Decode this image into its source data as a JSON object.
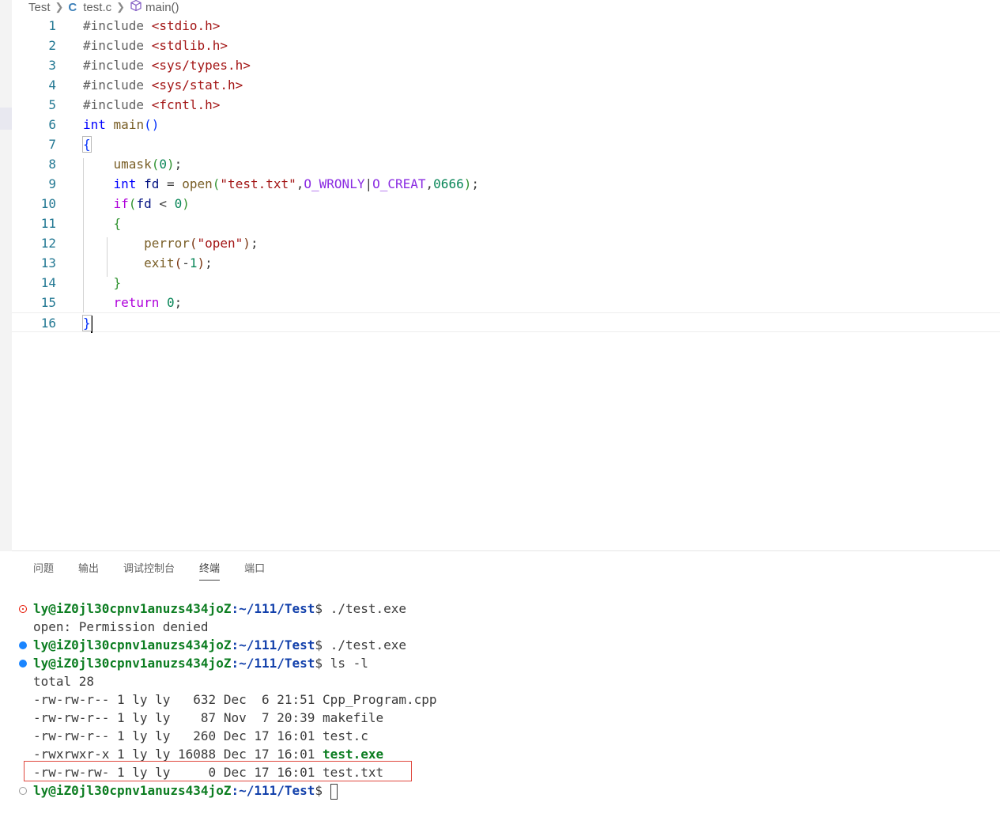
{
  "breadcrumb": {
    "folder": "Test",
    "file_icon": "C",
    "file": "test.c",
    "symbol": "main()",
    "symbol_icon": "cube-icon"
  },
  "editor": {
    "line_numbers": [
      "1",
      "2",
      "3",
      "4",
      "5",
      "6",
      "7",
      "8",
      "9",
      "10",
      "11",
      "12",
      "13",
      "14",
      "15",
      "16"
    ],
    "lines": [
      [
        {
          "c": "pp",
          "t": "#include "
        },
        {
          "c": "inc",
          "t": "<stdio.h>"
        }
      ],
      [
        {
          "c": "pp",
          "t": "#include "
        },
        {
          "c": "inc",
          "t": "<stdlib.h>"
        }
      ],
      [
        {
          "c": "pp",
          "t": "#include "
        },
        {
          "c": "inc",
          "t": "<sys/types.h>"
        }
      ],
      [
        {
          "c": "pp",
          "t": "#include "
        },
        {
          "c": "inc",
          "t": "<sys/stat.h>"
        }
      ],
      [
        {
          "c": "pp",
          "t": "#include "
        },
        {
          "c": "inc",
          "t": "<fcntl.h>"
        }
      ],
      [
        {
          "c": "kw",
          "t": "int"
        },
        {
          "c": "op",
          "t": " "
        },
        {
          "c": "fn",
          "t": "main"
        },
        {
          "c": "br1",
          "t": "()"
        }
      ],
      [
        {
          "c": "br1 bracket-box",
          "t": "{"
        }
      ],
      [
        {
          "c": "op",
          "t": "    "
        },
        {
          "c": "fn",
          "t": "umask"
        },
        {
          "c": "br2",
          "t": "("
        },
        {
          "c": "num",
          "t": "0"
        },
        {
          "c": "br2",
          "t": ")"
        },
        {
          "c": "op",
          "t": ";"
        }
      ],
      [
        {
          "c": "op",
          "t": "    "
        },
        {
          "c": "kw",
          "t": "int"
        },
        {
          "c": "op",
          "t": " "
        },
        {
          "c": "var",
          "t": "fd"
        },
        {
          "c": "op",
          "t": " = "
        },
        {
          "c": "fn",
          "t": "open"
        },
        {
          "c": "br2",
          "t": "("
        },
        {
          "c": "str",
          "t": "\"test.txt\""
        },
        {
          "c": "op",
          "t": ","
        },
        {
          "c": "mac",
          "t": "O_WRONLY"
        },
        {
          "c": "op",
          "t": "|"
        },
        {
          "c": "mac",
          "t": "O_CREAT"
        },
        {
          "c": "op",
          "t": ","
        },
        {
          "c": "num",
          "t": "0666"
        },
        {
          "c": "br2",
          "t": ")"
        },
        {
          "c": "op",
          "t": ";"
        }
      ],
      [
        {
          "c": "op",
          "t": "    "
        },
        {
          "c": "ctl",
          "t": "if"
        },
        {
          "c": "br2",
          "t": "("
        },
        {
          "c": "var",
          "t": "fd"
        },
        {
          "c": "op",
          "t": " < "
        },
        {
          "c": "num",
          "t": "0"
        },
        {
          "c": "br2",
          "t": ")"
        }
      ],
      [
        {
          "c": "op",
          "t": "    "
        },
        {
          "c": "br2",
          "t": "{"
        }
      ],
      [
        {
          "c": "op",
          "t": "        "
        },
        {
          "c": "fn",
          "t": "perror"
        },
        {
          "c": "br3",
          "t": "("
        },
        {
          "c": "str",
          "t": "\"open\""
        },
        {
          "c": "br3",
          "t": ")"
        },
        {
          "c": "op",
          "t": ";"
        }
      ],
      [
        {
          "c": "op",
          "t": "        "
        },
        {
          "c": "fn",
          "t": "exit"
        },
        {
          "c": "br3",
          "t": "("
        },
        {
          "c": "op",
          "t": "-"
        },
        {
          "c": "num",
          "t": "1"
        },
        {
          "c": "br3",
          "t": ")"
        },
        {
          "c": "op",
          "t": ";"
        }
      ],
      [
        {
          "c": "op",
          "t": "    "
        },
        {
          "c": "br2",
          "t": "}"
        }
      ],
      [
        {
          "c": "op",
          "t": "    "
        },
        {
          "c": "ctl",
          "t": "return"
        },
        {
          "c": "op",
          "t": " "
        },
        {
          "c": "num",
          "t": "0"
        },
        {
          "c": "op",
          "t": ";"
        }
      ],
      [
        {
          "c": "br1 bracket-box",
          "t": "}"
        }
      ]
    ]
  },
  "panel": {
    "tabs": [
      "问题",
      "输出",
      "调试控制台",
      "终端",
      "端口"
    ],
    "active_tab": "终端"
  },
  "terminal": {
    "lines": [
      {
        "decoration": "err",
        "prompt": {
          "user": "ly@iZ0jl30cpnv1anuzs434joZ",
          "path": ":~/111/Test",
          "sym": "$ ",
          "cmd": "./test.exe"
        }
      },
      {
        "text": "open: Permission denied"
      },
      {
        "decoration": "ok",
        "prompt": {
          "user": "ly@iZ0jl30cpnv1anuzs434joZ",
          "path": ":~/111/Test",
          "sym": "$ ",
          "cmd": "./test.exe"
        }
      },
      {
        "decoration": "ok",
        "prompt": {
          "user": "ly@iZ0jl30cpnv1anuzs434joZ",
          "path": ":~/111/Test",
          "sym": "$ ",
          "cmd": "ls -l"
        }
      },
      {
        "text": "total 28"
      },
      {
        "text": "-rw-rw-r-- 1 ly ly   632 Dec  6 21:51 Cpp_Program.cpp"
      },
      {
        "text": "-rw-rw-r-- 1 ly ly    87 Nov  7 20:39 makefile"
      },
      {
        "text": "-rw-rw-r-- 1 ly ly   260 Dec 17 16:01 test.c"
      },
      {
        "text": "-rwxrwxr-x 1 ly ly 16088 Dec 17 16:01 ",
        "exe": "test.exe"
      },
      {
        "text": "-rw-rw-rw- 1 ly ly     0 Dec 17 16:01 test.txt"
      },
      {
        "decoration": "idle",
        "prompt": {
          "user": "ly@iZ0jl30cpnv1anuzs434joZ",
          "path": ":~/111/Test",
          "sym": "$ ",
          "cmd": ""
        },
        "cursor": true
      }
    ]
  },
  "colors": {
    "annotation_box": "#e0483e",
    "prompt_user": "#0c7d21",
    "prompt_path": "#1240ab"
  }
}
